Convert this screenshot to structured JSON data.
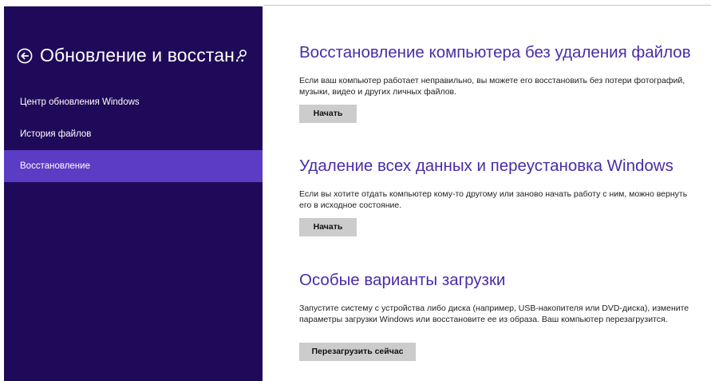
{
  "sidebar": {
    "title": "Обновление и восстан..",
    "back_icon": "back-arrow-circle-icon",
    "search_icon": "search-icon",
    "background_color": "#1f0a59",
    "selected_color": "#5b3cc4",
    "items": [
      {
        "label": "Центр обновления Windows",
        "selected": false
      },
      {
        "label": "История файлов",
        "selected": false
      },
      {
        "label": "Восстановление",
        "selected": true
      }
    ]
  },
  "main": {
    "accent_color": "#4a2ca8",
    "sections": [
      {
        "title": "Восстановление компьютера без удаления файлов",
        "description": "Если ваш компьютер работает неправильно, вы можете его восстановить без потери фотографий, музыки, видео и других личных файлов.",
        "button_label": "Начать"
      },
      {
        "title": "Удаление всех данных и переустановка Windows",
        "description": "Если вы хотите отдать компьютер кому-то другому или заново начать работу с ним, можно вернуть его в исходное состояние.",
        "button_label": "Начать"
      },
      {
        "title": "Особые варианты загрузки",
        "description": "Запустите систему с устройства либо диска (например, USB-накопителя или DVD-диска), измените параметры загрузки Windows или восстановите ее из образа. Ваш компьютер перезагрузится.",
        "button_label": "Перезагрузить сейчас"
      }
    ]
  }
}
